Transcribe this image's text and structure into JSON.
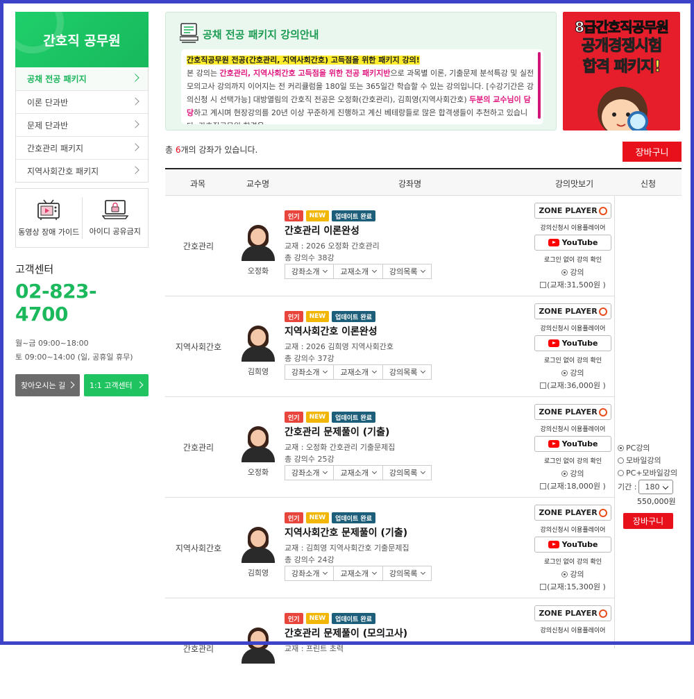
{
  "sidebar": {
    "title": "간호직 공무원",
    "menu": [
      {
        "label": "공채 전공 패키지"
      },
      {
        "label": "이론 단과반"
      },
      {
        "label": "문제 단과반"
      },
      {
        "label": "간호관리 패키지"
      },
      {
        "label": "지역사회간호 패키지"
      }
    ],
    "guide_label": "동영상 장애 가이드",
    "noshare_label": "아이디 공유금지",
    "cs_title": "고객센터",
    "cs_phone": "02-823-4700",
    "cs_hours1": "월~금 09:00~18:00",
    "cs_hours2": "토 09:00~14:00 (일, 공휴일 휴무)",
    "btn_directions": "찾아오시는 길",
    "btn_support": "1:1 고객센터"
  },
  "info": {
    "title": "공채 전공 패키지 강의안내",
    "highlight": "간호직공무원 전공(간호관리, 지역사회간호) 고득점을 위한 패키지 강의!",
    "p1": "본 강의는 ",
    "p1_pink": "간호관리, 지역사회간호 고득점을 위한 전공 패키지반",
    "p2": "으로 과목별 이론, 기출문제 분석특강 및 실전 모의고사 강의까지 이어지는 전 커리큘럼을 180일 또는 365일간 학습할 수 있는 강의입니다. [수강기간은 강의신청 시 선택가능] 대방열림의 간호직 전공은 오정화(간호관리), 김희영(지역사회간호) ",
    "p2_pink": "두분의 교수님이 담당",
    "p3": "하고 계시며 현장강의를 20년 이상 꾸준하게 진행하고 계신 베테랑들로 많은 합격생들이 추천하고 있습니다. 간호직공무원 합격을"
  },
  "banner": {
    "line1": "8급간호직공무원",
    "line2": "공개경쟁시험",
    "line3": "합격 패키지!"
  },
  "list": {
    "total_prefix": "총 ",
    "total_count": "6",
    "total_suffix": "개의 강좌가 있습니다.",
    "cart_label": "장바구니",
    "headers": {
      "subject": "과목",
      "professor": "교수명",
      "course": "강좌명",
      "preview": "강의맛보기",
      "apply": "신청"
    }
  },
  "badges": {
    "hot": "인기",
    "new": "NEW",
    "update": "업데이트 완료"
  },
  "common": {
    "dd_intro": "강좌소개",
    "dd_book": "교재소개",
    "dd_list": "강의목록",
    "zone_player": "ZONE PLAYER",
    "player_note": "강의신청시 이용플레이어",
    "youtube": "YouTube",
    "yt_note": "로그인 없이 강의 확인",
    "lecture_radio": "강의"
  },
  "courses": [
    {
      "subject": "간호관리",
      "professor": "오정화",
      "title": "간호관리 이론완성",
      "book": "교재 : 2026 오정화 간호관리",
      "count": "총 강의수 38강",
      "book_price": "(교재:31,500원 )"
    },
    {
      "subject": "지역사회간호",
      "professor": "김희영",
      "title": "지역사회간호 이론완성",
      "book": "교재 : 2026 김희영 지역사회간호",
      "count": "총 강의수 37강",
      "book_price": "(교재:36,000원 )"
    },
    {
      "subject": "간호관리",
      "professor": "오정화",
      "title": "간호관리 문제풀이 (기출)",
      "book": "교재 : 오정화 간호관리 기출문제집",
      "count": "총 강의수 25강",
      "book_price": "(교재:18,000원 )"
    },
    {
      "subject": "지역사회간호",
      "professor": "김희영",
      "title": "지역사회간호 문제풀이 (기출)",
      "book": "교재 : 김희영 지역사회간호 기출문제집",
      "count": "총 강의수 24강",
      "book_price": "(교재:15,300원 )"
    },
    {
      "subject": "간호관리",
      "professor": "오정화",
      "title": "간호관리 문제풀이 (모의고사)",
      "book": "교재 : 프린트 초력",
      "count": "",
      "book_price": ""
    }
  ],
  "apply": {
    "opt_pc": "PC강의",
    "opt_mobile": "모바일강의",
    "opt_both": "PC+모바일강의",
    "period_label": "기간 :",
    "period_value": "180",
    "price": "550,000원",
    "cart_label": "장바구니"
  },
  "colors": {
    "frame": "#3d43c9",
    "brand_green": "#1bb95c",
    "cart_red": "#e8101a",
    "pink": "#e0167f"
  }
}
